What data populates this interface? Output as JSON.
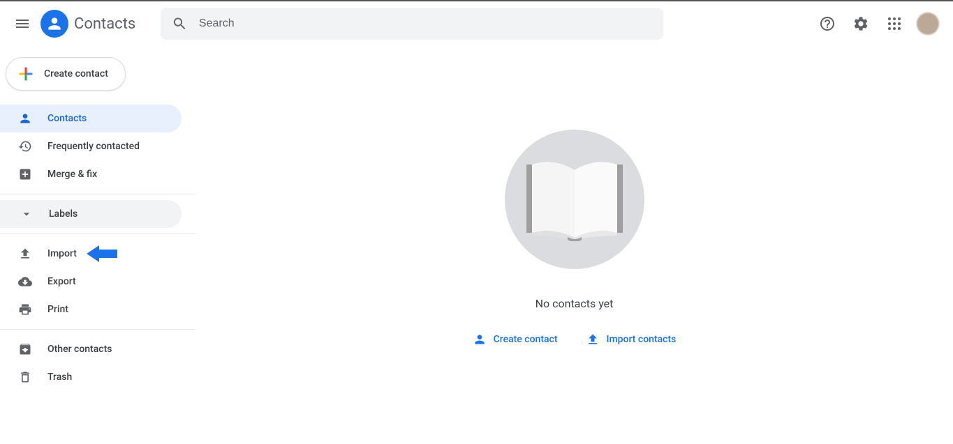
{
  "app": {
    "title": "Contacts"
  },
  "search": {
    "placeholder": "Search"
  },
  "sidebar": {
    "create": "Create contact",
    "nav": {
      "contacts": "Contacts",
      "frequent": "Frequently contacted",
      "merge": "Merge & fix",
      "labels": "Labels",
      "import": "Import",
      "export": "Export",
      "print": "Print",
      "other": "Other contacts",
      "trash": "Trash"
    }
  },
  "main": {
    "empty_title": "No contacts yet",
    "create_action": "Create contact",
    "import_action": "Import contacts"
  }
}
